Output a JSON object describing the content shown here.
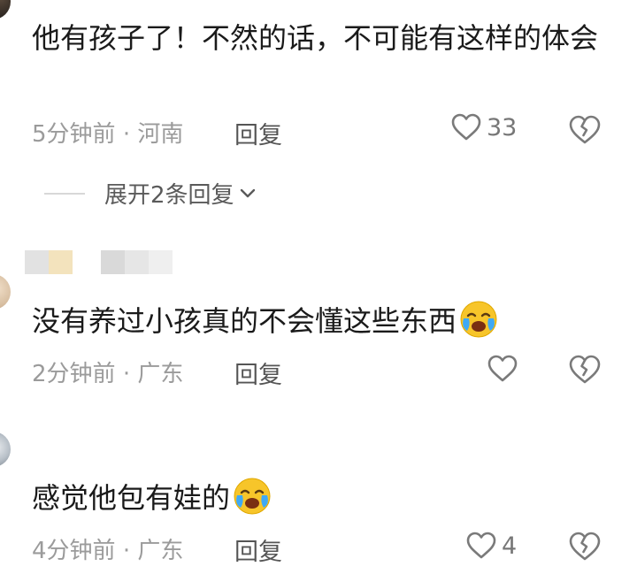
{
  "comments": [
    {
      "text": "他有孩子了！不然的话，不可能有这样的体会",
      "time": "5分钟前",
      "location": "河南",
      "reply_label": "回复",
      "likes": "33",
      "expand_label": "展开2条回复"
    },
    {
      "text": "没有养过小孩真的不会懂这些东西",
      "emoji": "crying-face-emoji",
      "time": "2分钟前",
      "location": "广东",
      "reply_label": "回复",
      "likes": ""
    },
    {
      "text": "感觉他包有娃的",
      "emoji": "crying-face-emoji",
      "time": "4分钟前",
      "location": "广东",
      "reply_label": "回复",
      "likes": "4"
    }
  ],
  "meta_separator": "·",
  "colors": {
    "meta": "#9b9b9b",
    "text": "#1a1a1a",
    "icon": "#7a7a7a"
  }
}
